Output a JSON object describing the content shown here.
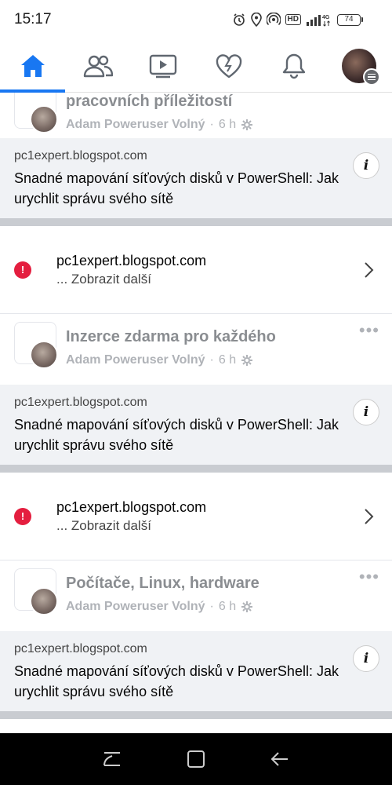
{
  "status_bar": {
    "time": "15:17",
    "hd_label": "HD",
    "network_label": "4G",
    "battery_level": "74",
    "icons": [
      "alarm-icon",
      "location-icon",
      "hotspot-icon",
      "hd-icon",
      "signal-icon",
      "battery-icon"
    ]
  },
  "tabs": [
    {
      "name": "home",
      "icon": "home-icon",
      "active": true
    },
    {
      "name": "friends",
      "icon": "friends-icon",
      "active": false
    },
    {
      "name": "watch",
      "icon": "video-icon",
      "active": false
    },
    {
      "name": "dating",
      "icon": "heart-icon",
      "active": false
    },
    {
      "name": "notifications",
      "icon": "bell-icon",
      "active": false
    },
    {
      "name": "menu",
      "icon": "profile-menu-icon",
      "active": false
    }
  ],
  "posts": [
    {
      "group_name": "pracovních příležitostí",
      "author": "Adam Poweruser Volný",
      "separator": "·",
      "time": "6 h",
      "link": {
        "domain": "pc1expert.blogspot.com",
        "title": "Snadné mapování síťových disků v PowerShell: Jak urychlit správu svého sítě"
      },
      "notice": {
        "domain": "pc1expert.blogspot.com",
        "more": "... Zobrazit další"
      }
    },
    {
      "group_name": "Inzerce zdarma pro každého",
      "author": "Adam Poweruser Volný",
      "separator": "·",
      "time": "6 h",
      "link": {
        "domain": "pc1expert.blogspot.com",
        "title": "Snadné mapování síťových disků v PowerShell: Jak urychlit správu svého sítě"
      },
      "notice": {
        "domain": "pc1expert.blogspot.com",
        "more": "... Zobrazit další"
      }
    },
    {
      "group_name": "Počítače, Linux, hardware",
      "author": "Adam Poweruser Volný",
      "separator": "·",
      "time": "6 h",
      "link": {
        "domain": "pc1expert.blogspot.com",
        "title": "Snadné mapování síťových disků v PowerShell: Jak urychlit správu svého sítě"
      }
    }
  ],
  "colors": {
    "accent": "#1877f2",
    "warning": "#e41e3f",
    "muted_text": "#8a8d91",
    "preview_bg": "#f0f2f5"
  },
  "nav_bar": [
    "recent-apps-icon",
    "home-button-icon",
    "back-icon"
  ]
}
